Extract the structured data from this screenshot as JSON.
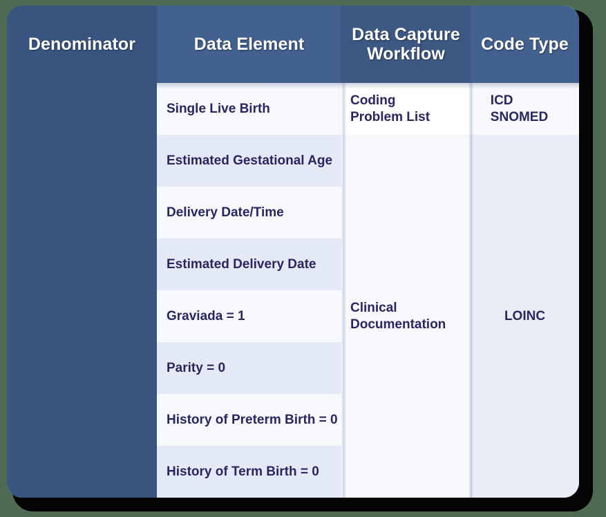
{
  "theme": {
    "page_background": "#4d6b51",
    "card_shadow": "#040404",
    "header_dark": "#3a5480",
    "header_medium": "#43618e",
    "header_workflow": "#3c5883",
    "row_light": "#f6f8fc",
    "row_tint": "#e3e9f5",
    "codetype_body": "#e8edf7",
    "text_navy": "#2b2560",
    "header_text": "#ffffff"
  },
  "table": {
    "columns": [
      {
        "key": "denominator",
        "label": "Denominator"
      },
      {
        "key": "data_element",
        "label": "Data Element"
      },
      {
        "key": "data_capture_workflow",
        "label": "Data Capture\nWorkflow"
      },
      {
        "key": "code_type",
        "label": "Code Type"
      }
    ],
    "headers": {
      "denominator": "Denominator",
      "data_element": "Data Element",
      "data_capture_workflow_line1": "Data Capture",
      "data_capture_workflow_line2": "Workflow",
      "code_type": "Code Type"
    },
    "denominator_cell": "",
    "data_elements": [
      "Single Live Birth",
      "Estimated Gestational Age",
      "Delivery Date/Time",
      "Estimated Delivery Date",
      "Graviada = 1",
      "Parity = 0",
      "History of Preterm Birth = 0",
      "History of Term Birth = 0"
    ],
    "data_capture_workflow": {
      "coding_line1": "Coding",
      "coding_line2": "Problem List",
      "clinical_line1": "Clinical",
      "clinical_line2": "Documentation"
    },
    "code_type": {
      "icd_line1": "ICD",
      "icd_line2": "SNOMED",
      "loinc": "LOINC"
    }
  }
}
